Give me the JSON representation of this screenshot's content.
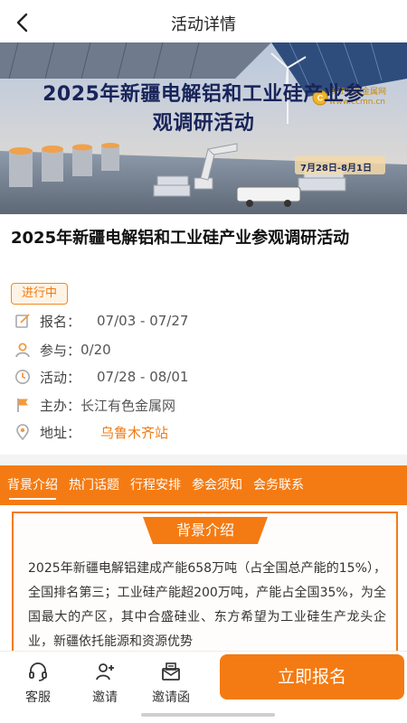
{
  "nav": {
    "title": "活动详情"
  },
  "banner": {
    "headline_line1": "2025年新疆电解铝和工业硅产业参",
    "headline_line2": "观调研活动",
    "date_range": "7月28日-8月1日",
    "logo_name": "长江有色金属网",
    "logo_url": "www.ccmn.cn"
  },
  "event": {
    "title": "2025年新疆电解铝和工业硅产业参观调研活动",
    "status": "进行中"
  },
  "info": {
    "registration": {
      "label": "报名：",
      "value": "07/03 - 07/27"
    },
    "participants": {
      "label": "参与：",
      "value": "0/20"
    },
    "activity": {
      "label": "活动：",
      "value": "07/28 - 08/01"
    },
    "organizer": {
      "label": "主办：",
      "value": "长江有色金属网"
    },
    "address": {
      "label": "地址：",
      "value": "乌鲁木齐站"
    }
  },
  "tabs": [
    {
      "label": "背景介绍"
    },
    {
      "label": "热门话题"
    },
    {
      "label": "行程安排"
    },
    {
      "label": "参会须知"
    },
    {
      "label": "会务联系"
    }
  ],
  "background": {
    "heading": "背景介绍",
    "text": "2025年新疆电解铝建成产能658万吨（占全国总产能的15%），全国排名第三；工业硅产能超200万吨，产能占全国35%，为全国最大的产区，其中合盛硅业、东方希望为工业硅生产龙头企业，新疆依托能源和资源优势"
  },
  "bottom": {
    "service": "客服",
    "invite": "邀请",
    "invitation_letter": "邀请函",
    "signup": "立即报名"
  },
  "colors": {
    "accent": "#f47b13",
    "banner_title": "#18245a"
  }
}
